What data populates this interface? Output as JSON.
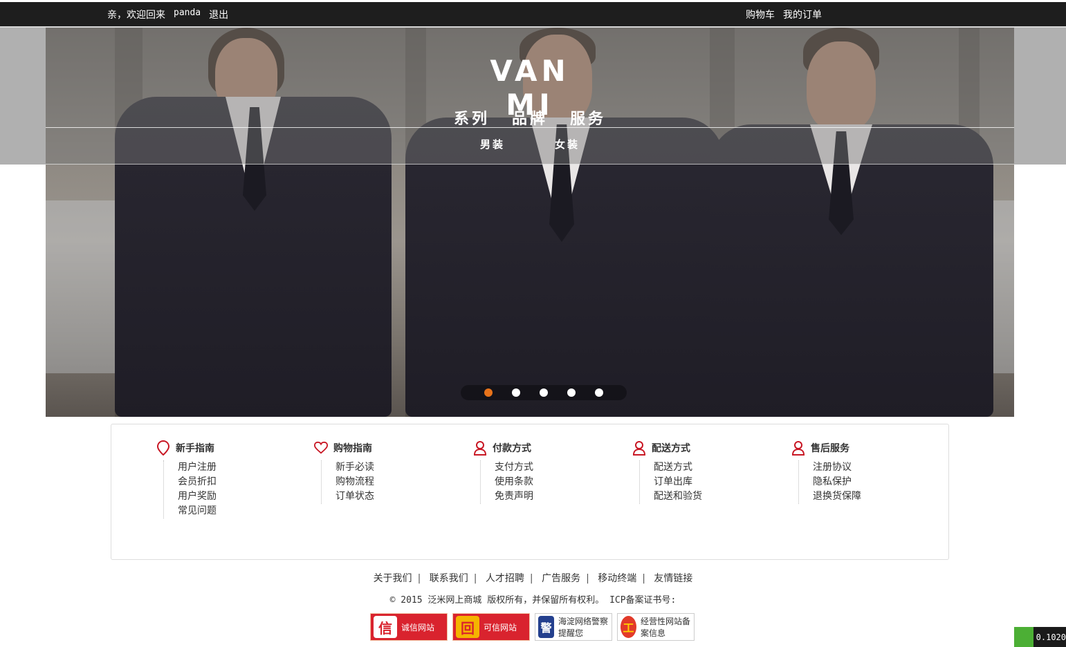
{
  "topbar": {
    "greeting": "亲，欢迎回来",
    "username": "panda",
    "logout": "退出",
    "cart": "购物车",
    "orders": "我的订单"
  },
  "hero": {
    "logo": "VAN MI",
    "main_nav": [
      "系列",
      "品牌",
      "服务"
    ],
    "sub_nav": [
      "男装",
      "女装"
    ],
    "slide_count": 5,
    "active_slide": 1,
    "colors": {
      "active_dot": "#e8731a",
      "dot": "#ffffff"
    }
  },
  "help": {
    "columns": [
      {
        "icon": "pin-icon",
        "title": "新手指南",
        "items": [
          "用户注册",
          "会员折扣",
          "用户奖励",
          "常见问题"
        ]
      },
      {
        "icon": "heart-icon",
        "title": "购物指南",
        "items": [
          "新手必读",
          "购物流程",
          "订单状态"
        ]
      },
      {
        "icon": "user-icon",
        "title": "付款方式",
        "items": [
          "支付方式",
          "使用条款",
          "免责声明"
        ]
      },
      {
        "icon": "user-icon",
        "title": "配送方式",
        "items": [
          "配送方式",
          "订单出库",
          "配送和验货"
        ]
      },
      {
        "icon": "user-icon",
        "title": "售后服务",
        "items": [
          "注册协议",
          "隐私保护",
          "退换货保障"
        ]
      }
    ],
    "icon_color": "#c81623"
  },
  "footer": {
    "links": [
      "关于我们",
      "联系我们",
      "人才招聘",
      "广告服务",
      "移动终端",
      "友情链接"
    ],
    "copyright": "© 2015 泛米网上商城 版权所有，并保留所有权利。 ICP备案证书号:",
    "badges": [
      {
        "icon": "credit-seal-icon",
        "glyph": "信",
        "label": "诚信网站"
      },
      {
        "icon": "trust-site-icon",
        "glyph": "回",
        "label": "可信网站"
      },
      {
        "icon": "police-icon",
        "glyph": "警",
        "label": "海淀网络警察提醒您"
      },
      {
        "icon": "registry-icon",
        "glyph": "工",
        "label": "经营性网站备案信息"
      }
    ]
  },
  "meter": {
    "value": "0.1020"
  }
}
